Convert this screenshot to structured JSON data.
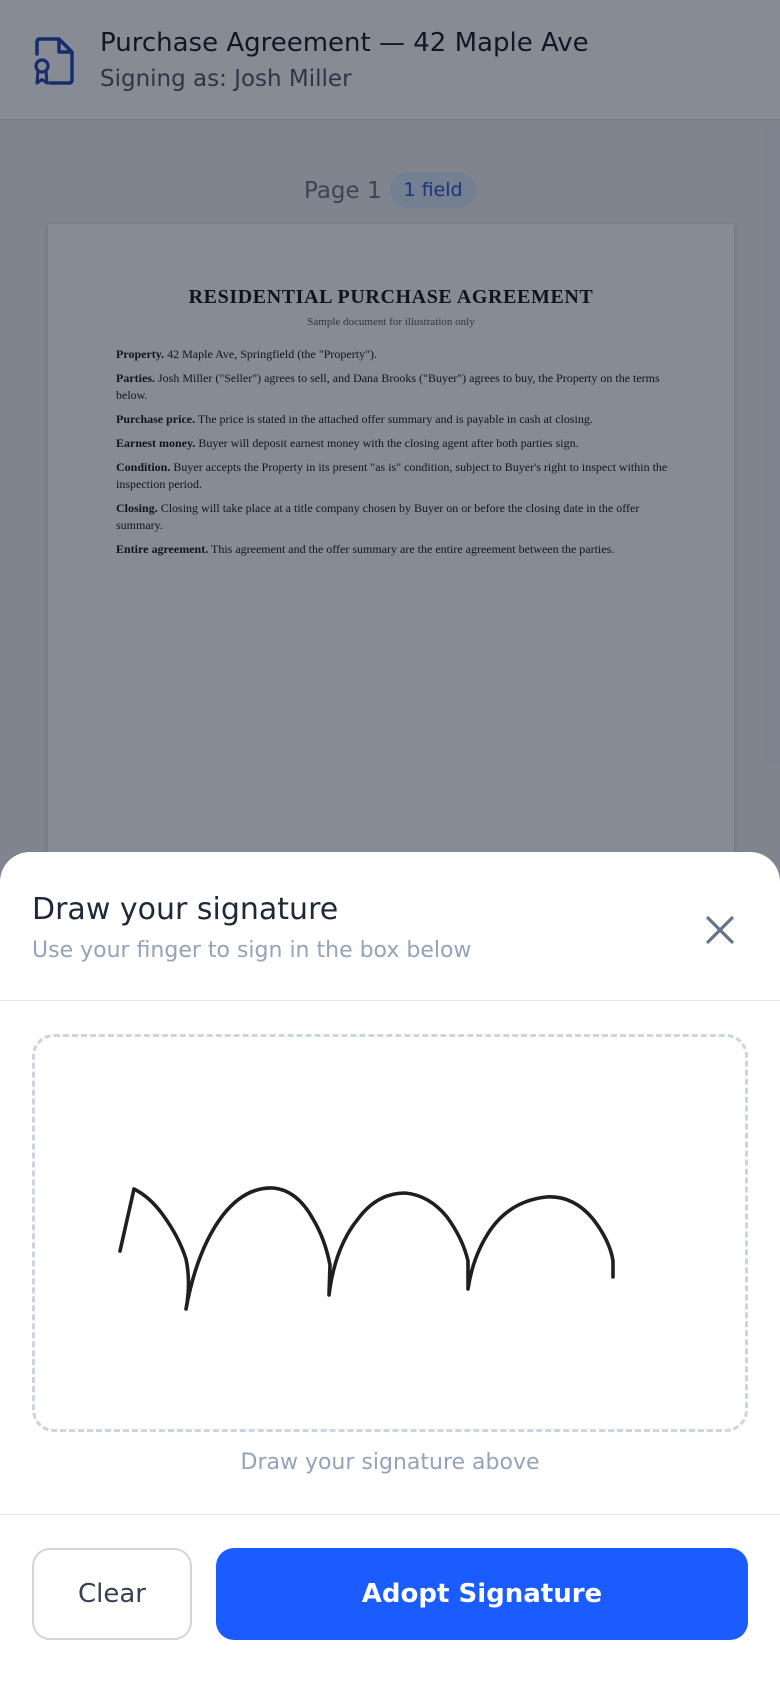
{
  "header": {
    "title": "Purchase Agreement — 42 Maple Ave",
    "subtitle": "Signing as: Josh Miller",
    "icon": "document-signature-icon"
  },
  "page": {
    "label": "Page 1",
    "field_badge": "1 field"
  },
  "document": {
    "heading": "RESIDENTIAL PURCHASE AGREEMENT",
    "note": "Sample document for illustration only",
    "clauses": [
      {
        "term": "Property.",
        "text": " 42 Maple Ave, Springfield (the \"Property\")."
      },
      {
        "term": "Parties.",
        "text": " Josh Miller (\"Seller\") agrees to sell, and Dana Brooks (\"Buyer\") agrees to buy, the Property on the terms below."
      },
      {
        "term": "Purchase price.",
        "text": " The price is stated in the attached offer summary and is payable in cash at closing."
      },
      {
        "term": "Earnest money.",
        "text": " Buyer will deposit earnest money with the closing agent after both parties sign."
      },
      {
        "term": "Condition.",
        "text": " Buyer accepts the Property in its present \"as is\" condition, subject to Buyer's right to inspect within the inspection period."
      },
      {
        "term": "Closing.",
        "text": " Closing will take place at a title company chosen by Buyer on or before the closing date in the offer summary."
      },
      {
        "term": "Entire agreement.",
        "text": " This agreement and the offer summary are the entire agreement between the parties."
      }
    ]
  },
  "signature_sheet": {
    "title": "Draw your signature",
    "subtitle": "Use your finger to sign in the box below",
    "hint": "Draw your signature above",
    "clear_label": "Clear",
    "adopt_label": "Adopt Signature",
    "close_icon": "close-icon"
  },
  "colors": {
    "accent": "#1a5cff",
    "badge_bg": "#d8e6fb",
    "badge_text": "#2554c7",
    "icon_blue": "#1e40af"
  }
}
